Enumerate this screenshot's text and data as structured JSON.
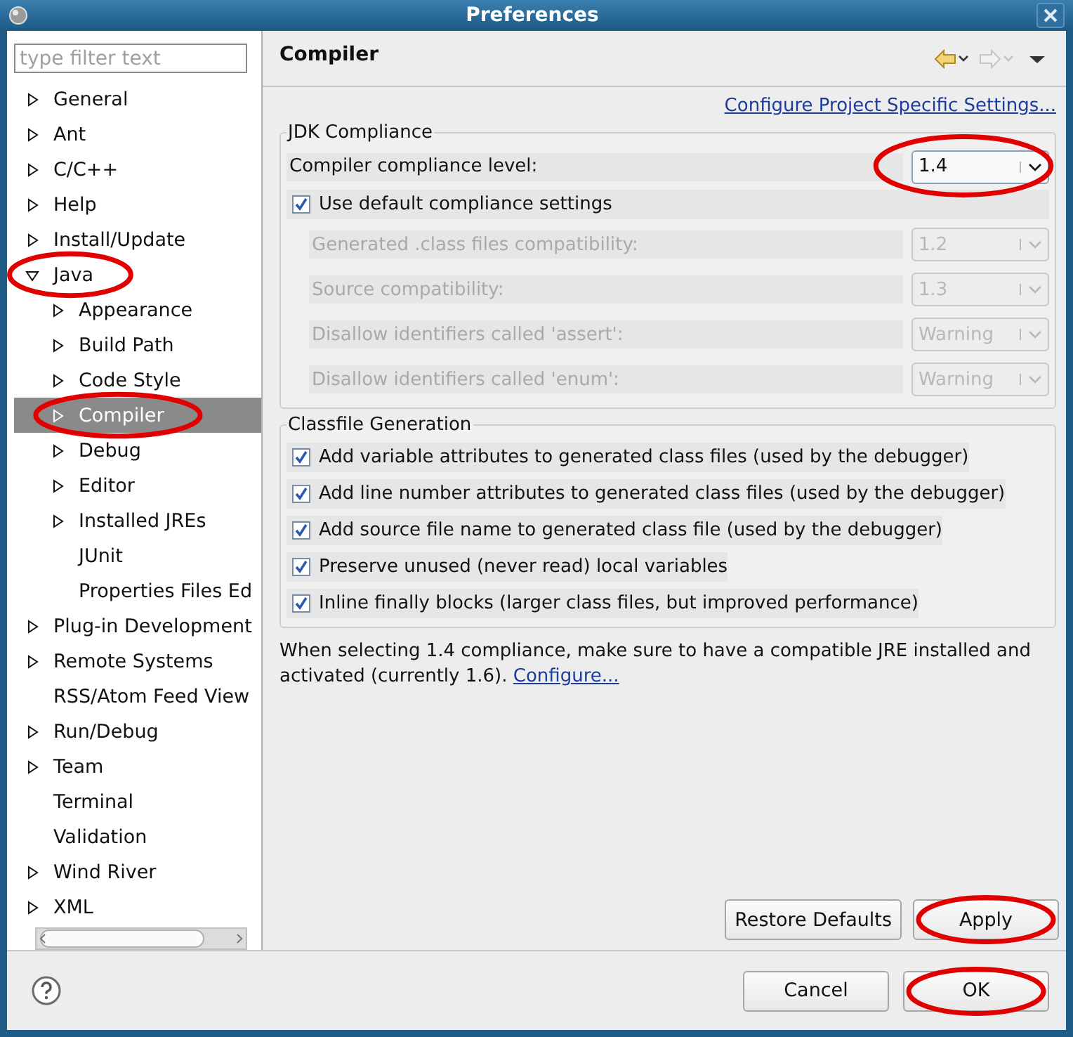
{
  "window": {
    "title": "Preferences"
  },
  "sidebar": {
    "filter": {
      "placeholder": "type filter text"
    },
    "tree": [
      {
        "label": "General",
        "kind": "branch",
        "expanded": false,
        "selected": false,
        "annotated": false
      },
      {
        "label": "Ant",
        "kind": "branch",
        "expanded": false,
        "selected": false,
        "annotated": false
      },
      {
        "label": "C/C++",
        "kind": "branch",
        "expanded": false,
        "selected": false,
        "annotated": false
      },
      {
        "label": "Help",
        "kind": "branch",
        "expanded": false,
        "selected": false,
        "annotated": false
      },
      {
        "label": "Install/Update",
        "kind": "branch",
        "expanded": false,
        "selected": false,
        "annotated": false
      },
      {
        "label": "Java",
        "kind": "branch",
        "expanded": true,
        "selected": false,
        "annotated": true,
        "children": [
          {
            "label": "Appearance",
            "kind": "branch",
            "expanded": false,
            "selected": false,
            "annotated": false
          },
          {
            "label": "Build Path",
            "kind": "branch",
            "expanded": false,
            "selected": false,
            "annotated": false
          },
          {
            "label": "Code Style",
            "kind": "branch",
            "expanded": false,
            "selected": false,
            "annotated": false
          },
          {
            "label": "Compiler",
            "kind": "branch",
            "expanded": false,
            "selected": true,
            "annotated": true
          },
          {
            "label": "Debug",
            "kind": "branch",
            "expanded": false,
            "selected": false,
            "annotated": false
          },
          {
            "label": "Editor",
            "kind": "branch",
            "expanded": false,
            "selected": false,
            "annotated": false
          },
          {
            "label": "Installed JREs",
            "kind": "branch",
            "expanded": false,
            "selected": false,
            "annotated": false
          },
          {
            "label": "JUnit",
            "kind": "leaf",
            "selected": false,
            "annotated": false
          },
          {
            "label": "Properties Files Ed",
            "kind": "leaf",
            "selected": false,
            "annotated": false
          }
        ]
      },
      {
        "label": "Plug-in Development",
        "kind": "branch",
        "expanded": false,
        "selected": false,
        "annotated": false
      },
      {
        "label": "Remote Systems",
        "kind": "branch",
        "expanded": false,
        "selected": false,
        "annotated": false
      },
      {
        "label": "RSS/Atom Feed View",
        "kind": "leaf",
        "selected": false,
        "annotated": false
      },
      {
        "label": "Run/Debug",
        "kind": "branch",
        "expanded": false,
        "selected": false,
        "annotated": false
      },
      {
        "label": "Team",
        "kind": "branch",
        "expanded": false,
        "selected": false,
        "annotated": false
      },
      {
        "label": "Terminal",
        "kind": "leaf",
        "selected": false,
        "annotated": false
      },
      {
        "label": "Validation",
        "kind": "leaf",
        "selected": false,
        "annotated": false
      },
      {
        "label": "Wind River",
        "kind": "branch",
        "expanded": false,
        "selected": false,
        "annotated": false
      },
      {
        "label": "XML",
        "kind": "branch",
        "expanded": false,
        "selected": false,
        "annotated": false
      }
    ]
  },
  "page": {
    "title": "Compiler",
    "project_link": "Configure Project Specific Settings...",
    "jdk_compliance": {
      "title": "JDK Compliance",
      "compliance_level": {
        "label": "Compiler compliance level:",
        "value": "1.4",
        "annotated": true
      },
      "use_default": {
        "label": "Use default compliance settings",
        "checked": true
      },
      "settings": [
        {
          "label": "Generated .class files compatibility:",
          "value": "1.2",
          "disabled": true
        },
        {
          "label": "Source compatibility:",
          "value": "1.3",
          "disabled": true
        },
        {
          "label": "Disallow identifiers called 'assert':",
          "value": "Warning",
          "disabled": true
        },
        {
          "label": "Disallow identifiers called 'enum':",
          "value": "Warning",
          "disabled": true
        }
      ]
    },
    "classfile_generation": {
      "title": "Classfile Generation",
      "options": [
        {
          "label": "Add variable attributes to generated class files (used by the debugger)",
          "checked": true
        },
        {
          "label": "Add line number attributes to generated class files (used by the debugger)",
          "checked": true
        },
        {
          "label": "Add source file name to generated class file (used by the debugger)",
          "checked": true
        },
        {
          "label": "Preserve unused (never read) local variables",
          "checked": true
        },
        {
          "label": "Inline finally blocks (larger class files, but improved performance)",
          "checked": true
        }
      ]
    },
    "note": {
      "text": "When selecting 1.4 compliance, make sure to have a compatible JRE installed and activated (currently 1.6).",
      "link": "Configure..."
    },
    "buttons": [
      {
        "label": "Restore Defaults",
        "annotated": false
      },
      {
        "label": "Apply",
        "annotated": true
      }
    ]
  },
  "dialog_buttons": [
    {
      "label": "Cancel",
      "annotated": false
    },
    {
      "label": "OK",
      "annotated": true
    }
  ]
}
